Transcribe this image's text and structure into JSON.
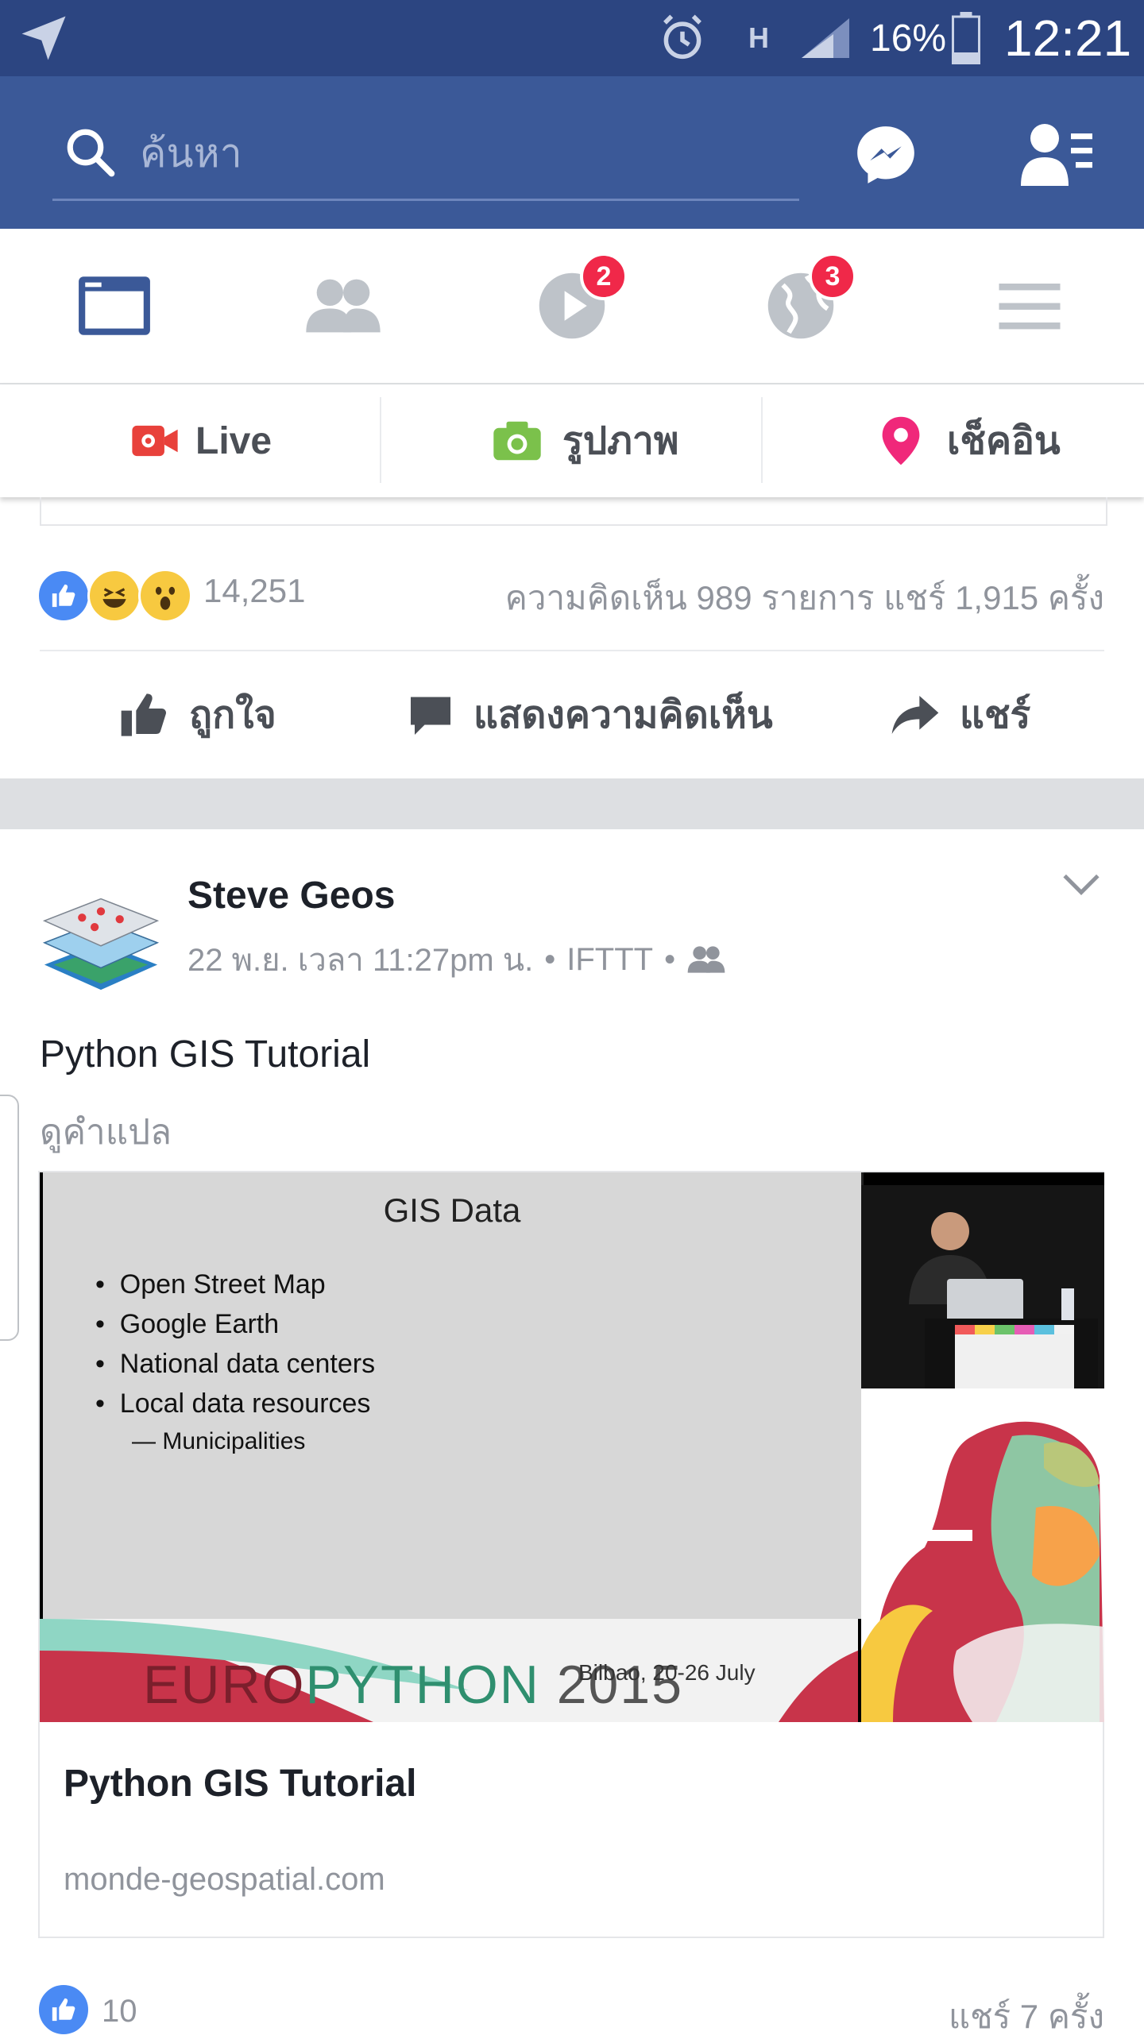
{
  "status_bar": {
    "battery_percent": "16%",
    "network": "H",
    "time": "12:21"
  },
  "header": {
    "search_placeholder": "ค้นหา"
  },
  "tabs": [
    {
      "name": "news-feed",
      "badge": ""
    },
    {
      "name": "friends",
      "badge": ""
    },
    {
      "name": "video",
      "badge": "2"
    },
    {
      "name": "notifications",
      "badge": "3"
    },
    {
      "name": "menu",
      "badge": ""
    }
  ],
  "composer": {
    "live": "Live",
    "photo": "รูปภาพ",
    "checkin": "เช็คอิน"
  },
  "post1": {
    "reaction_count": "14,251",
    "comment_share_stats": "ความคิดเห็น 989 รายการ  แชร์ 1,915 ครั้ง",
    "actions": {
      "like": "ถูกใจ",
      "comment": "แสดงความคิดเห็น",
      "share": "แชร์"
    }
  },
  "post2": {
    "author": "Steve Geos",
    "timestamp": "22 พ.ย. เวลา 11:27pm น.",
    "source": "IFTTT",
    "text": "Python GIS Tutorial",
    "see_translation": "ดูคำแปล",
    "preview": {
      "slide_title": "GIS Data",
      "bullets": [
        "Open Street Map",
        "Google Earth",
        "National data centers",
        "Local data resources"
      ],
      "sub_bullet": "— Municipalities",
      "event_name_euro": "EURO",
      "event_name_python": "PYTHON",
      "event_year": "2015",
      "event_location_date": "Bilbao, 20-26 July"
    },
    "link_title": "Python GIS Tutorial",
    "link_domain": "monde-geospatial.com",
    "like_count": "10",
    "share_count": "แชร์ 7 ครั้ง"
  },
  "colors": {
    "brand_blue": "#3b5998",
    "status_bar": "#2c4581",
    "badge_red": "#f02849",
    "muted_text": "#90949c"
  }
}
